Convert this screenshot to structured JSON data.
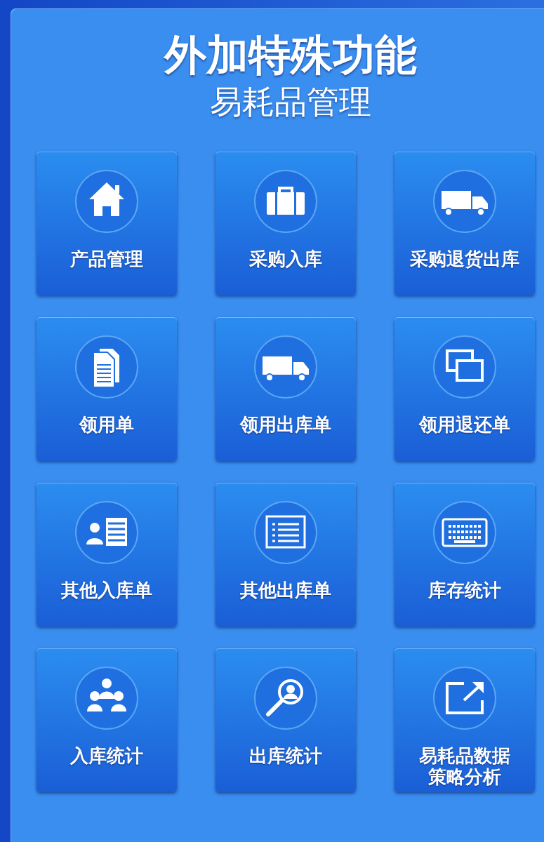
{
  "header": {
    "title": "外加特殊功能",
    "subtitle": "易耗品管理"
  },
  "tiles": [
    {
      "label": "产品管理"
    },
    {
      "label": "采购入库"
    },
    {
      "label": "采购退货出库"
    },
    {
      "label": "领用单"
    },
    {
      "label": "领用出库单"
    },
    {
      "label": "领用退还单"
    },
    {
      "label": "其他入库单"
    },
    {
      "label": "其他出库单"
    },
    {
      "label": "库存统计"
    },
    {
      "label": "入库统计"
    },
    {
      "label": "出库统计"
    },
    {
      "label": "易耗品数据策略分析"
    }
  ]
}
